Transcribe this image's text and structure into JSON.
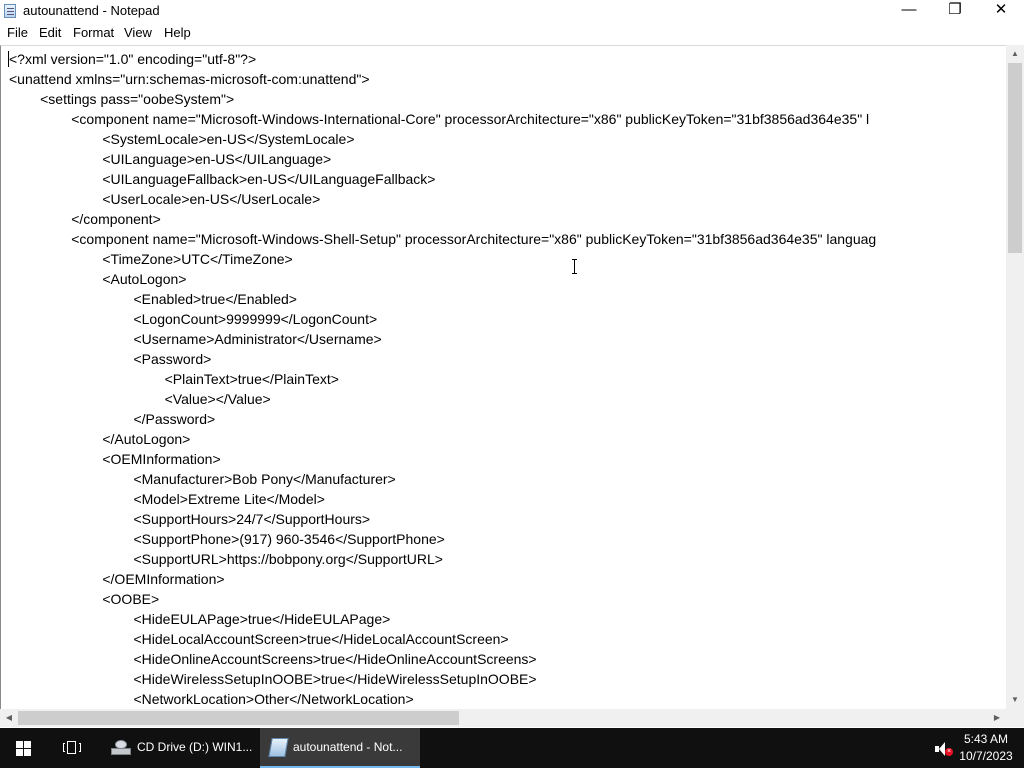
{
  "window": {
    "title": "autounattend - Notepad",
    "controls": {
      "minimize": "—",
      "maximize": "❐",
      "close": "✕"
    }
  },
  "menu": {
    "file": "File",
    "edit": "Edit",
    "format": "Format",
    "view": "View",
    "help": "Help"
  },
  "document": {
    "lines": [
      "<?xml version=\"1.0\" encoding=\"utf-8\"?>",
      "<unattend xmlns=\"urn:schemas-microsoft-com:unattend\">",
      "\t<settings pass=\"oobeSystem\">",
      "\t\t<component name=\"Microsoft-Windows-International-Core\" processorArchitecture=\"x86\" publicKeyToken=\"31bf3856ad364e35\" l",
      "\t\t\t<SystemLocale>en-US</SystemLocale>",
      "\t\t\t<UILanguage>en-US</UILanguage>",
      "\t\t\t<UILanguageFallback>en-US</UILanguageFallback>",
      "\t\t\t<UserLocale>en-US</UserLocale>",
      "\t\t</component>",
      "\t\t<component name=\"Microsoft-Windows-Shell-Setup\" processorArchitecture=\"x86\" publicKeyToken=\"31bf3856ad364e35\" languag",
      "\t\t\t<TimeZone>UTC</TimeZone>",
      "\t\t\t<AutoLogon>",
      "\t\t\t\t<Enabled>true</Enabled>",
      "\t\t\t\t<LogonCount>9999999</LogonCount>",
      "\t\t\t\t<Username>Administrator</Username>",
      "\t\t\t\t<Password>",
      "\t\t\t\t\t<PlainText>true</PlainText>",
      "\t\t\t\t\t<Value></Value>",
      "\t\t\t\t</Password>",
      "\t\t\t</AutoLogon>",
      "\t\t\t<OEMInformation>",
      "\t\t\t\t<Manufacturer>Bob Pony</Manufacturer>",
      "\t\t\t\t<Model>Extreme Lite</Model>",
      "\t\t\t\t<SupportHours>24/7</SupportHours>",
      "\t\t\t\t<SupportPhone>(917) 960-3546</SupportPhone>",
      "\t\t\t\t<SupportURL>https://bobpony.org</SupportURL>",
      "\t\t\t</OEMInformation>",
      "\t\t\t<OOBE>",
      "\t\t\t\t<HideEULAPage>true</HideEULAPage>",
      "\t\t\t\t<HideLocalAccountScreen>true</HideLocalAccountScreen>",
      "\t\t\t\t<HideOnlineAccountScreens>true</HideOnlineAccountScreens>",
      "\t\t\t\t<HideWirelessSetupInOOBE>true</HideWirelessSetupInOOBE>",
      "\t\t\t\t<NetworkLocation>Other</NetworkLocation>"
    ]
  },
  "taskbar": {
    "cd_drive_label": "CD Drive (D:) WIN1...",
    "notepad_label": "autounattend - Not...",
    "time": "5:43 AM",
    "date": "10/7/2023"
  },
  "icons": {
    "app": "notepad-icon",
    "start": "windows-logo-icon",
    "task_view": "task-view-icon",
    "cd": "cd-drive-icon",
    "volume": "volume-muted-icon"
  }
}
